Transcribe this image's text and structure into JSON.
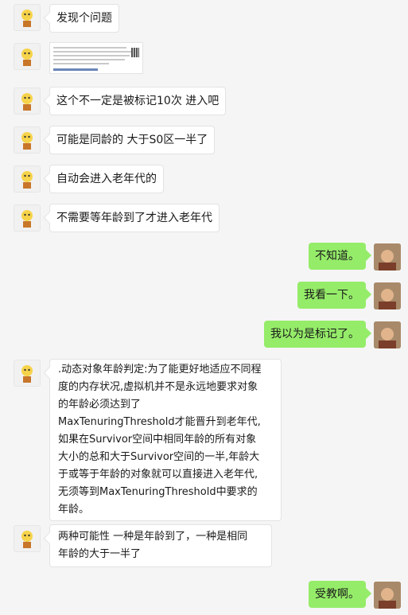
{
  "messages": [
    {
      "side": "left",
      "type": "text",
      "text": "发现个问题"
    },
    {
      "side": "left",
      "type": "image",
      "image_desc": "screenshot-thumbnail"
    },
    {
      "side": "left",
      "type": "text",
      "text": "这个不一定是被标记10次 进入吧"
    },
    {
      "side": "left",
      "type": "text",
      "text": "可能是同龄的 大于S0区一半了"
    },
    {
      "side": "left",
      "type": "text",
      "text": "自动会进入老年代的"
    },
    {
      "side": "left",
      "type": "text",
      "text": "不需要等年龄到了才进入老年代"
    },
    {
      "side": "right",
      "type": "text",
      "text": "不知道。"
    },
    {
      "side": "right",
      "type": "text",
      "text": "我看一下。"
    },
    {
      "side": "right",
      "type": "text",
      "text": "我以为是标记了。"
    },
    {
      "side": "left",
      "type": "text",
      "lines": [
        ".动态对象年龄判定:为了能更好地适应不同程",
        "度的内存状况,虚拟机并不是永远地要求对象",
        "的年龄必须达到了",
        "MaxTenuringThreshold才能晋升到老年代,",
        "如果在Survivor空间中相同年龄的所有对象",
        "大小的总和大于Survivor空间的一半,年龄大",
        "于或等于年龄的对象就可以直接进入老年代,",
        "无须等到MaxTenuringThreshold中要求的",
        "年龄。"
      ]
    },
    {
      "side": "left",
      "type": "text",
      "lines": [
        "两种可能性 一种是年龄到了，一种是相同",
        "年龄的大于一半了"
      ]
    },
    {
      "side": "right",
      "type": "text",
      "text": "受教啊。"
    }
  ]
}
